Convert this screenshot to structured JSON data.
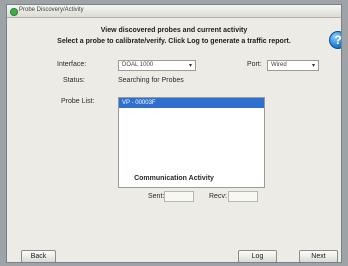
{
  "window": {
    "title": "Probe Discovery/Activity"
  },
  "header": {
    "line1": "View discovered probes and current activity",
    "line2": "Select a probe to calibrate/verify.  Click Log to generate a traffic report."
  },
  "help": {
    "glyph": "?"
  },
  "form": {
    "interface_label": "Interface:",
    "interface_value": "DOAL 1000",
    "port_label": "Port:",
    "port_value": "Wired",
    "status_label": "Status:",
    "status_value": "Searching for Probes",
    "probe_list_label": "Probe List:",
    "probe_list_items": [
      "VP - 00003F"
    ]
  },
  "activity": {
    "title": "Communication Activity",
    "sent_label": "Sent:",
    "recv_label": "Recv:"
  },
  "buttons": {
    "back": "Back",
    "log": "Log",
    "next": "Next"
  },
  "icons": {
    "app": "app-icon",
    "help": "help-icon",
    "dropdown": "chevron-down-icon"
  },
  "colors": {
    "selection": "#2f6fd0",
    "help": "#1f7fd6"
  }
}
